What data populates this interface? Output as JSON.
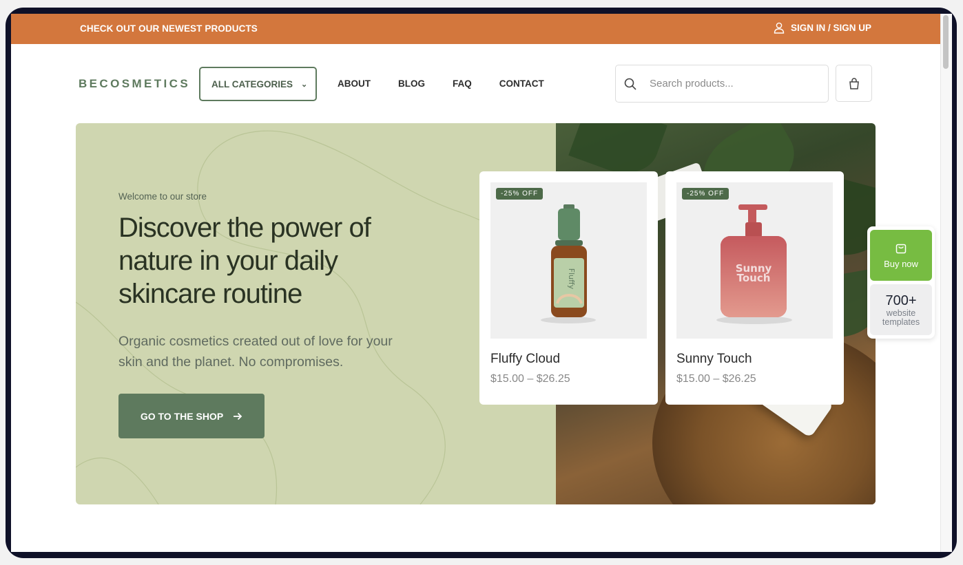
{
  "topbar": {
    "promo": "CHECK OUT OUR NEWEST PRODUCTS",
    "signin": "SIGN IN / SIGN UP",
    "color": "#d3773d"
  },
  "header": {
    "logo": "BECOSMETICS",
    "categories_label": "ALL CATEGORIES",
    "nav": [
      "ABOUT",
      "BLOG",
      "FAQ",
      "CONTACT"
    ],
    "search_placeholder": "Search products..."
  },
  "hero": {
    "welcome": "Welcome to our store",
    "title": "Discover the power of nature in your daily skincare routine",
    "subtitle": "Organic cosmetics created out of love for your skin and the planet. No compromises.",
    "cta": "GO TO THE SHOP",
    "bg_color": "#cfd6b0",
    "accent": "#5e7a5e"
  },
  "products": [
    {
      "badge": "-25% OFF",
      "name": "Fluffy Cloud",
      "price": "$15.00 – $26.25"
    },
    {
      "badge": "-25% OFF",
      "name": "Sunny Touch",
      "price": "$15.00 – $26.25"
    }
  ],
  "widget": {
    "buy_label": "Buy now",
    "count": "700+",
    "templates_line1": "website",
    "templates_line2": "templates",
    "color": "#77bc42"
  },
  "icons": {
    "user": "user-icon",
    "search": "search-icon",
    "cart": "shopping-bag-icon",
    "chevron": "chevron-down-icon",
    "arrow": "arrow-right-icon"
  }
}
